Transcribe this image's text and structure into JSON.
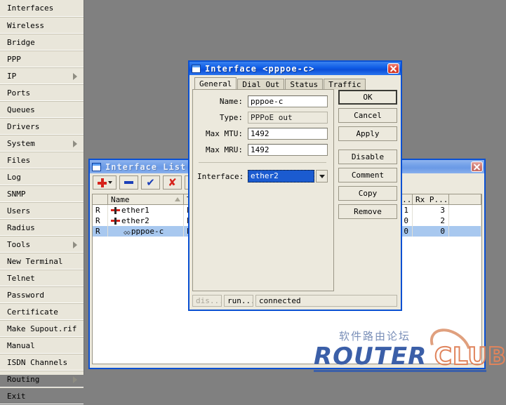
{
  "sidebar": {
    "items": [
      {
        "label": "Interfaces",
        "arrow": false
      },
      {
        "label": "Wireless",
        "arrow": false
      },
      {
        "label": "Bridge",
        "arrow": false
      },
      {
        "label": "PPP",
        "arrow": false
      },
      {
        "label": "IP",
        "arrow": true
      },
      {
        "label": "Ports",
        "arrow": false
      },
      {
        "label": "Queues",
        "arrow": false
      },
      {
        "label": "Drivers",
        "arrow": false
      },
      {
        "label": "System",
        "arrow": true
      },
      {
        "label": "Files",
        "arrow": false
      },
      {
        "label": "Log",
        "arrow": false
      },
      {
        "label": "SNMP",
        "arrow": false
      },
      {
        "label": "Users",
        "arrow": false
      },
      {
        "label": "Radius",
        "arrow": false
      },
      {
        "label": "Tools",
        "arrow": true
      },
      {
        "label": "New Terminal",
        "arrow": false
      },
      {
        "label": "Telnet",
        "arrow": false
      },
      {
        "label": "Password",
        "arrow": false
      },
      {
        "label": "Certificate",
        "arrow": false
      },
      {
        "label": "Make Supout.rif",
        "arrow": false
      },
      {
        "label": "Manual",
        "arrow": false
      },
      {
        "label": "ISDN Channels",
        "arrow": false
      },
      {
        "label": "Routing",
        "arrow": true
      },
      {
        "label": "Exit",
        "arrow": false
      }
    ]
  },
  "interface_list": {
    "title": "Interface List",
    "toolbar": [
      {
        "name": "add",
        "icon": "plus-icon"
      },
      {
        "name": "remove",
        "icon": "minus-icon"
      },
      {
        "name": "enable",
        "icon": "check-icon"
      },
      {
        "name": "disable",
        "icon": "cross-icon"
      },
      {
        "name": "comment",
        "icon": "folder-icon"
      }
    ],
    "columns": [
      "",
      "Name",
      "Ty",
      "Tx P...",
      "Rx P...",
      ""
    ],
    "rows": [
      {
        "flag": "R",
        "name": "ether1",
        "type": "Et",
        "tx": "1",
        "rx": "3",
        "icon": "ethernet-icon",
        "indent": false,
        "selected": false
      },
      {
        "flag": "R",
        "name": "ether2",
        "type": "Et",
        "tx": "0",
        "rx": "2",
        "icon": "ethernet-icon",
        "indent": false,
        "selected": false
      },
      {
        "flag": "R",
        "name": "pppoe-c",
        "type": "PPI",
        "tx": "0",
        "rx": "0",
        "icon": "ppp-icon",
        "indent": true,
        "selected": true
      }
    ]
  },
  "interface_dialog": {
    "title": "Interface <pppoe-c>",
    "tabs": [
      {
        "label": "General",
        "active": true
      },
      {
        "label": "Dial Out",
        "active": false
      },
      {
        "label": "Status",
        "active": false
      },
      {
        "label": "Traffic",
        "active": false
      }
    ],
    "fields": {
      "name_label": "Name:",
      "name_value": "pppoe-c",
      "type_label": "Type:",
      "type_value": "PPPoE out",
      "mtu_label": "Max MTU:",
      "mtu_value": "1492",
      "mru_label": "Max MRU:",
      "mru_value": "1492",
      "interface_label": "Interface:",
      "interface_value": "ether2"
    },
    "buttons": [
      {
        "label": "OK",
        "default": true,
        "gap": false
      },
      {
        "label": "Cancel",
        "default": false,
        "gap": false
      },
      {
        "label": "Apply",
        "default": false,
        "gap": false
      },
      {
        "label": "Disable",
        "default": false,
        "gap": true
      },
      {
        "label": "Comment",
        "default": false,
        "gap": false
      },
      {
        "label": "Copy",
        "default": false,
        "gap": false
      },
      {
        "label": "Remove",
        "default": false,
        "gap": false
      }
    ],
    "status": {
      "disabled": "dis...",
      "running": "run...",
      "connection": "connected"
    }
  },
  "watermark": {
    "chinese": "软件路由论坛",
    "router": "ROUTER",
    "club": "CLUB"
  },
  "colors": {
    "desktop": "#808080",
    "window_face": "#ece9dd",
    "title_active": "#0f5ce6",
    "title_inactive": "#6f9ee8",
    "selection": "#a8c8ef",
    "combo_selection": "#1b5bd0",
    "accent_red": "#d6241c",
    "accent_blue": "#1b3fb8"
  }
}
